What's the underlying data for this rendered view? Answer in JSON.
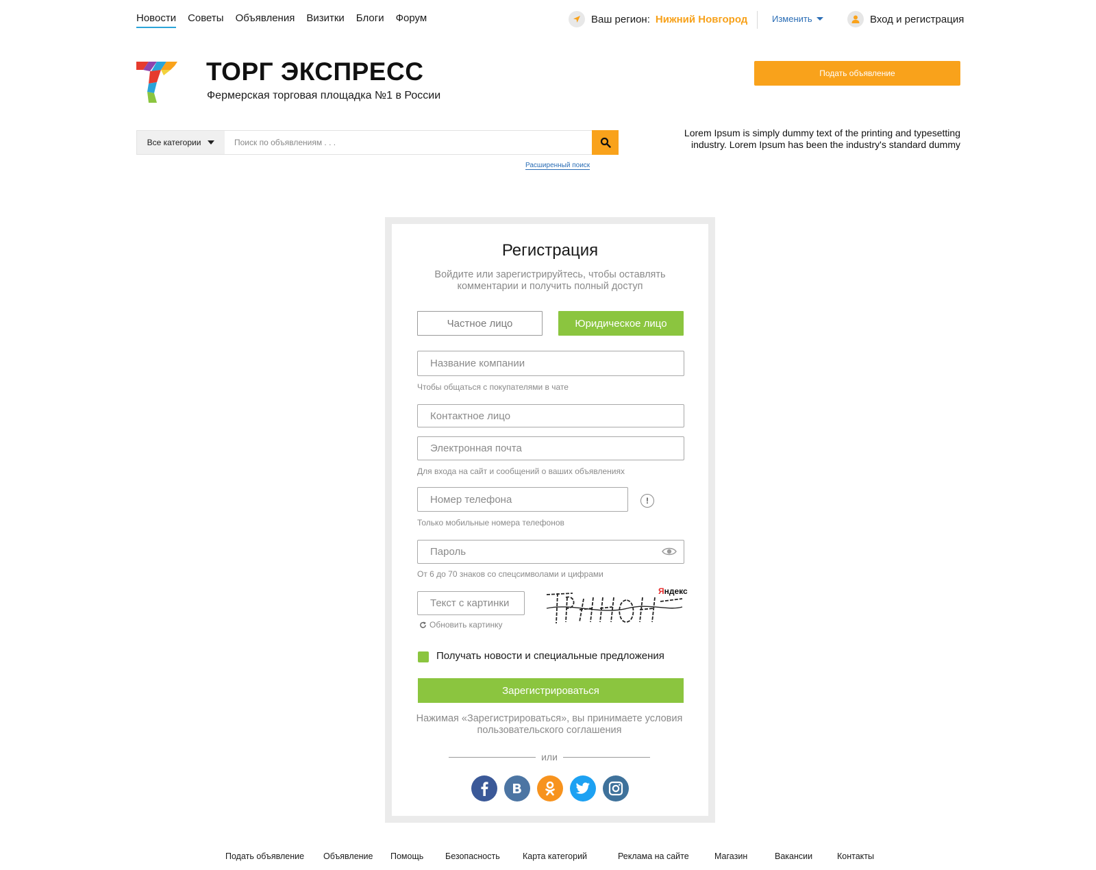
{
  "nav": {
    "items": [
      {
        "label": "Новости",
        "active": true
      },
      {
        "label": "Советы"
      },
      {
        "label": "Объявления"
      },
      {
        "label": "Визитки"
      },
      {
        "label": "Блоги"
      },
      {
        "label": "Форум"
      }
    ]
  },
  "region": {
    "label": "Ваш регион:",
    "city": "Нижний Новгород",
    "change": "Изменить"
  },
  "account": {
    "login": "Вход и регистрация"
  },
  "header": {
    "brand": "ТОРГ ЭКСПРЕСС",
    "tagline": "Фермерская торговая площадка №1 в России",
    "post_ad": "Подать объявление"
  },
  "search": {
    "category": "Все категории",
    "placeholder": "Поиск по объявлениям . . .",
    "advanced": "Расширенный поиск"
  },
  "promo": {
    "text": "Lorem Ipsum is simply dummy text of the printing and typesetting industry. Lorem Ipsum has been the industry's standard dummy"
  },
  "form": {
    "title": "Регистрация",
    "subtitle": "Войдите или зарегистрируйтесь, чтобы оставлять комментарии и получить полный доступ",
    "tabs": {
      "private": "Частное лицо",
      "legal": "Юридическое лицо"
    },
    "company": {
      "placeholder": "Название компании",
      "hint": "Чтобы общаться с покупателями в чате"
    },
    "contact": {
      "placeholder": "Контактное лицо"
    },
    "email": {
      "placeholder": "Электронная почта",
      "hint": "Для входа на сайт и сообщений о ваших объявлениях"
    },
    "phone": {
      "placeholder": "Номер телефона",
      "hint": "Только мобильные номера телефонов",
      "info": "!"
    },
    "password": {
      "placeholder": "Пароль",
      "hint": "От 6 до 70 знаков со спецсимволами и цифрами"
    },
    "captcha": {
      "placeholder": "Текст с картинки",
      "refresh": "Обновить картинку",
      "brand_first": "Я",
      "brand_rest": "ндекс"
    },
    "newsletter": {
      "label": "Получать новости и специальные предложения",
      "checked": true
    },
    "submit": "Зарегистрироваться",
    "terms": "Нажимая «Зарегистрироваться», вы принимаете условия пользовательского соглашения",
    "or": "или",
    "social": [
      "facebook",
      "vk",
      "odnoklassniki",
      "twitter",
      "instagram"
    ]
  },
  "footer": {
    "links": [
      "Подать объявление",
      "Объявление",
      "Помощь",
      "Безопасность",
      "Карта категорий",
      "Реклама на сайте",
      "Магазин",
      "Вакансии",
      "Контакты"
    ]
  },
  "colors": {
    "accent_orange": "#f9a21b",
    "accent_green": "#8bc53f",
    "link_blue": "#2a6db5",
    "facebook": "#3b5998",
    "vk": "#4c75a3",
    "odnoklassniki": "#f7931e",
    "twitter": "#1da1f2",
    "instagram": "#3f729b"
  }
}
